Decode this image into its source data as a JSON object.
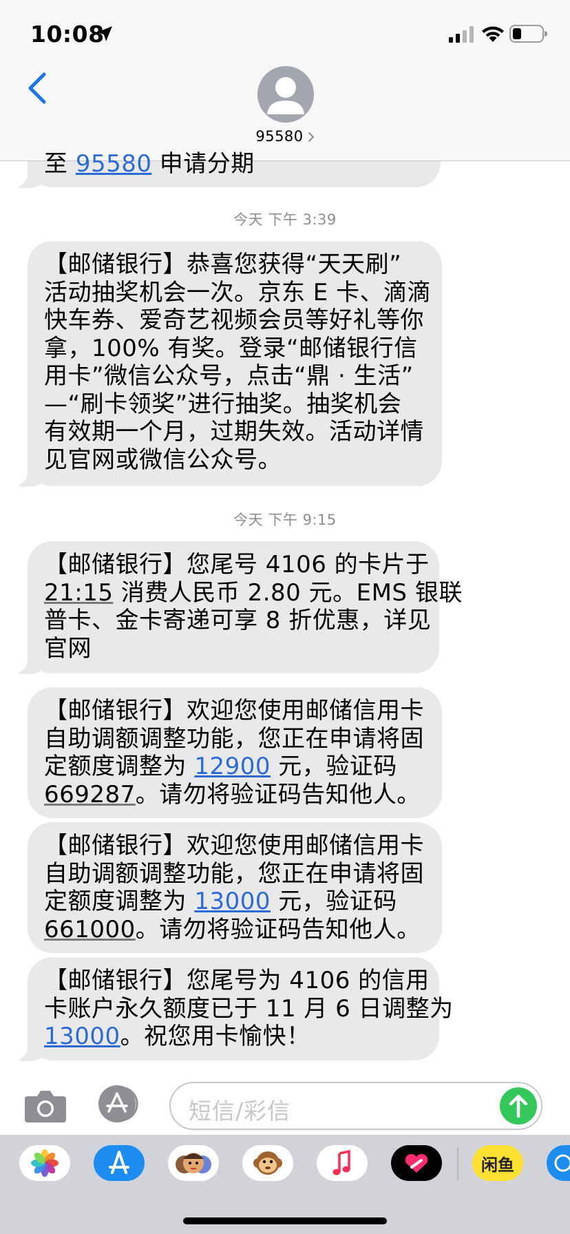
{
  "status_bar": {
    "time": "10:08"
  },
  "header": {
    "contact": "95580"
  },
  "messages": {
    "partial": {
      "line1_a": "至 ",
      "line1_link": "95580",
      "line1_b": " 申请分期"
    },
    "ts1": "今天 下午 3:39",
    "m1": {
      "l1": "【邮储银行】恭喜您获得“天天刷”",
      "l2": "活动抽奖机会一次。京东 E 卡、滴滴",
      "l3": "快车券、爱奇艺视频会员等好礼等你",
      "l4": "拿，100% 有奖。登录“邮储银行信",
      "l5": "用卡”微信公众号，点击“鼎 · 生活”",
      "l6": "—“刷卡领奖”进行抽奖。抽奖机会",
      "l7": "有效期一个月，过期失效。活动详情",
      "l8": "见官网或微信公众号。"
    },
    "ts2": "今天 下午 9:15",
    "m2": {
      "l1": "【邮储银行】您尾号 4106 的卡片于",
      "l2_time": "21:15",
      "l2_rest": " 消费人民币 2.80 元。EMS 银联",
      "l3": "普卡、金卡寄递可享 8 折优惠，详见",
      "l4": "官网"
    },
    "m3": {
      "l1": "【邮储银行】欢迎您使用邮储信用卡",
      "l2": "自助调额调整功能，您正在申请将固",
      "l3_a": "定额度调整为 ",
      "l3_link": "12900",
      "l3_b": " 元，验证码",
      "l4_code": "669287",
      "l4_rest": "。请勿将验证码告知他人。"
    },
    "m4": {
      "l1": "【邮储银行】欢迎您使用邮储信用卡",
      "l2": "自助调额调整功能，您正在申请将固",
      "l3_a": "定额度调整为 ",
      "l3_link": "13000",
      "l3_b": " 元，验证码",
      "l4_code": "661000",
      "l4_rest": "。请勿将验证码告知他人。"
    },
    "m5": {
      "l1": "【邮储银行】您尾号为 4106 的信用",
      "l2": "卡账户永久额度已于 11 月 6 日调整为",
      "l3_link": "13000",
      "l3_rest": "。祝您用卡愉快！"
    }
  },
  "input": {
    "placeholder": "短信/彩信"
  },
  "drawer": {
    "apps": [
      "photos-app",
      "app-store-app",
      "memoji-app",
      "animoji-app",
      "music-app",
      "digital-touch-app",
      "xianyu-app",
      "next-app"
    ],
    "xianyu_label": "闲鱼"
  },
  "colors": {
    "link": "#2c6bd6",
    "bubble": "#e9e9eb",
    "send": "#34c759",
    "header": "#f7f7f7"
  }
}
